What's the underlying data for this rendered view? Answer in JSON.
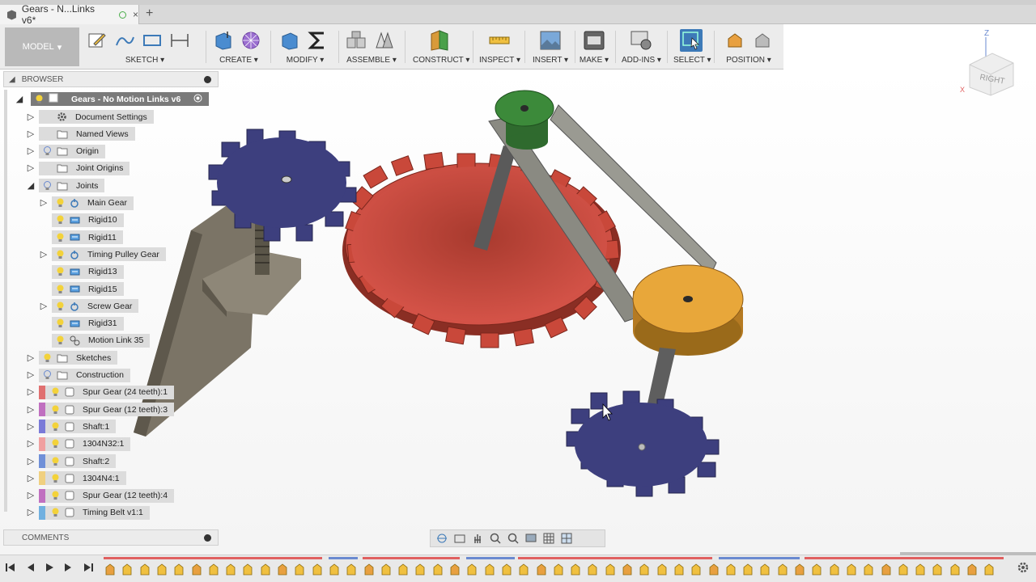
{
  "window": {
    "tab_title": "Gears - N...Links v6*",
    "add_tab": "+",
    "close_tab": "×"
  },
  "toolbar": {
    "model_label": "MODEL",
    "groups": {
      "sketch": "SKETCH",
      "create": "CREATE",
      "modify": "MODIFY",
      "assemble": "ASSEMBLE",
      "construct": "CONSTRUCT",
      "inspect": "INSPECT",
      "insert": "INSERT",
      "make": "MAKE",
      "addins": "ADD-INS",
      "select": "SELECT",
      "position": "POSITION"
    }
  },
  "browser": {
    "title": "BROWSER",
    "root": "Gears - No Motion Links v6",
    "items": [
      {
        "label": "Document Settings"
      },
      {
        "label": "Named Views"
      },
      {
        "label": "Origin"
      },
      {
        "label": "Joint Origins"
      },
      {
        "label": "Joints"
      },
      {
        "label": "Main Gear"
      },
      {
        "label": "Rigid10"
      },
      {
        "label": "Rigid11"
      },
      {
        "label": "Timing Pulley Gear"
      },
      {
        "label": "Rigid13"
      },
      {
        "label": "Rigid15"
      },
      {
        "label": "Screw Gear"
      },
      {
        "label": "Rigid31"
      },
      {
        "label": "Motion Link 35"
      },
      {
        "label": "Sketches"
      },
      {
        "label": "Construction"
      },
      {
        "label": "Spur Gear (24 teeth):1",
        "color": "#e07070"
      },
      {
        "label": "Spur Gear (12 teeth):3",
        "color": "#c070c0"
      },
      {
        "label": "Shaft:1",
        "color": "#7a7ad8"
      },
      {
        "label": "1304N32:1",
        "color": "#f0a0a0"
      },
      {
        "label": "Shaft:2",
        "color": "#7090d8"
      },
      {
        "label": "1304N4:1",
        "color": "#f0d080"
      },
      {
        "label": "Spur Gear (12 teeth):4",
        "color": "#c070c0"
      },
      {
        "label": "Timing Belt v1:1",
        "color": "#70b0e0"
      }
    ]
  },
  "comments": {
    "title": "COMMENTS"
  },
  "viewcube": {
    "face": "RIGHT",
    "axis_z": "Z",
    "axis_x": "X"
  },
  "colors": {
    "red_gear": "#c9483a",
    "blue_gear": "#3d3f7e",
    "green_pulley": "#3c8a3a",
    "orange_pulley": "#e8a73a",
    "accent": "#3d7ab8"
  }
}
